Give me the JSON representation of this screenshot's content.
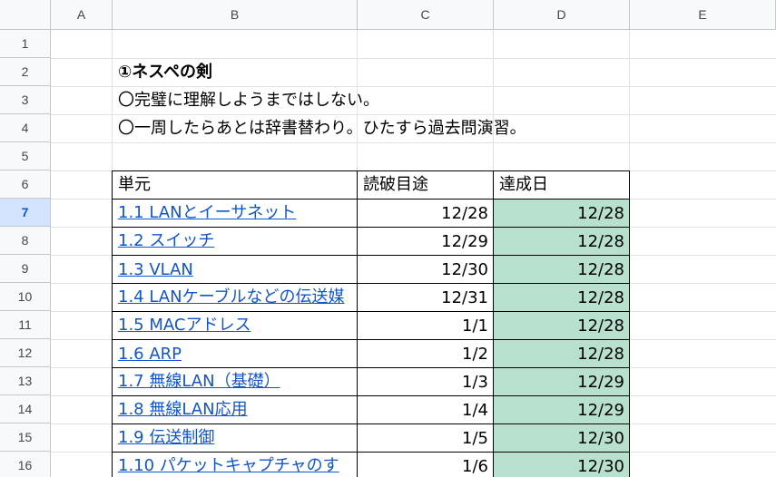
{
  "columns": [
    "A",
    "B",
    "C",
    "D",
    "E"
  ],
  "rows": [
    "1",
    "2",
    "3",
    "4",
    "5",
    "6",
    "7",
    "8",
    "9",
    "10",
    "11",
    "12",
    "13",
    "14",
    "15",
    "16"
  ],
  "selected_row": "7",
  "notes": {
    "title": "①ネスペの剣",
    "line1": "〇完璧に理解しようまではしない。",
    "line2": "〇一周したらあとは辞書替わり。ひたすら過去問演習。"
  },
  "table": {
    "headers": [
      "単元",
      "読破目途",
      "達成日"
    ],
    "rows": [
      {
        "unit": "1.1 LANとイーサネット",
        "target": "12/28",
        "done": "12/28"
      },
      {
        "unit": "1.2 スイッチ",
        "target": "12/29",
        "done": "12/28"
      },
      {
        "unit": "1.3 VLAN",
        "target": "12/30",
        "done": "12/28"
      },
      {
        "unit": "1.4 LANケーブルなどの伝送媒",
        "target": "12/31",
        "done": "12/28"
      },
      {
        "unit": "1.5 MACアドレス",
        "target": "1/1",
        "done": "12/28"
      },
      {
        "unit": "1.6 ARP",
        "target": "1/2",
        "done": "12/28"
      },
      {
        "unit": "1.7 無線LAN（基礎）",
        "target": "1/3",
        "done": "12/29"
      },
      {
        "unit": "1.8 無線LAN応用",
        "target": "1/4",
        "done": "12/29"
      },
      {
        "unit": "1.9 伝送制御",
        "target": "1/5",
        "done": "12/30"
      },
      {
        "unit": "1.10 パケットキャプチャのす",
        "target": "1/6",
        "done": "12/30"
      }
    ]
  },
  "colors": {
    "done_fill": "#b7e1cd",
    "link": "#1155cc",
    "selected_header": "#d3e3fd"
  }
}
